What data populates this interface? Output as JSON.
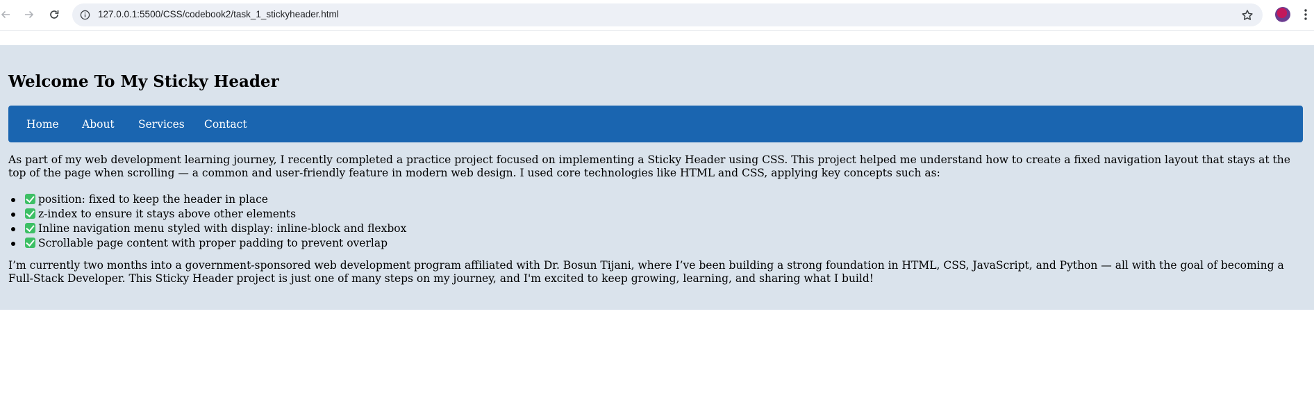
{
  "browser": {
    "url": "127.0.0.1:5500/CSS/codebook2/task_1_stickyheader.html",
    "icons": {
      "back": "back-arrow-icon",
      "forward": "forward-arrow-icon",
      "reload": "reload-icon",
      "site_info": "info-icon",
      "bookmark": "star-icon",
      "profile": "avatar",
      "menu": "kebab-menu-icon"
    }
  },
  "page": {
    "title": "Welcome To My Sticky Header",
    "nav": {
      "items": [
        {
          "label": "Home"
        },
        {
          "label": "About"
        },
        {
          "label": "Services"
        },
        {
          "label": "Contact"
        }
      ]
    },
    "intro": "As part of my web development learning journey, I recently completed a practice project focused on implementing a Sticky Header using CSS. This project helped me understand how to create a fixed navigation layout that stays at the top of the page when scrolling — a common and user-friendly feature in modern web design. I used core technologies like HTML and CSS, applying key concepts such as:",
    "bullets": [
      {
        "text": "position: fixed to keep the header in place"
      },
      {
        "text": "z-index to ensure it stays above other elements"
      },
      {
        "text": "Inline navigation menu styled with display: inline-block and flexbox"
      },
      {
        "text": "Scrollable page content with proper padding to prevent overlap"
      }
    ],
    "outro": "I’m currently two months into a government-sponsored web development program affiliated with Dr. Bosun Tijani, where I’ve been building a strong foundation in HTML, CSS, JavaScript, and Python — all with the goal of becoming a Full-Stack Developer. This Sticky Header project is just one of many steps on my journey, and I'm excited to keep growing, learning, and sharing what I build!"
  },
  "colors": {
    "page_background": "#dae3ec",
    "nav_background": "#1a65b0",
    "nav_text": "#ffffff",
    "check_green": "#3dbf65",
    "omnibox_background": "#edf0f6"
  }
}
